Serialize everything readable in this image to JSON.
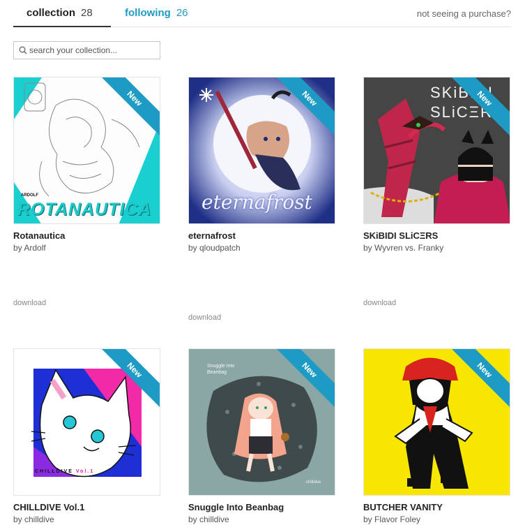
{
  "tabs": {
    "collection": {
      "label": "collection",
      "count": "28"
    },
    "following": {
      "label": "following",
      "count": "26"
    }
  },
  "purchase_link": "not seeing a purchase?",
  "search": {
    "placeholder": "search your collection..."
  },
  "items": [
    {
      "title": "Rotanautica",
      "artist": "by Ardolf",
      "badge": "New",
      "cover_text": "ROTANAUTICA",
      "cover_small": "ARDOLF",
      "download": "download",
      "accent": "#00c9c9"
    },
    {
      "title": "eternafrost",
      "artist": "by qloudpatch",
      "badge": "New",
      "cover_text": "eternafrost",
      "download": "download",
      "accent": "#2b3a8c"
    },
    {
      "title": "SKiBIDI SLiCΞRS",
      "artist": "by Wyvren vs. Franky",
      "badge": "New",
      "cover_text": "SKiBIDI SLiCΞRS",
      "download": "download",
      "accent": "#c0254a"
    },
    {
      "title": "CHILLDIVE Vol.1",
      "artist": "by chilldive",
      "badge": "New",
      "cover_text": "CHILLDIVE",
      "cover_small": "Vol.1",
      "download": "",
      "accent": "#2634c8"
    },
    {
      "title": "Snuggle Into Beanbag",
      "artist": "by chilldive",
      "badge": "New",
      "cover_text": "Snuggle Into Beanbag",
      "cover_small": "chilldive",
      "download": "",
      "accent": "#8aa7a6"
    },
    {
      "title": "BUTCHER VANITY",
      "artist": "by Flavor Foley",
      "badge": "New",
      "download": "",
      "accent": "#f6e600"
    }
  ]
}
